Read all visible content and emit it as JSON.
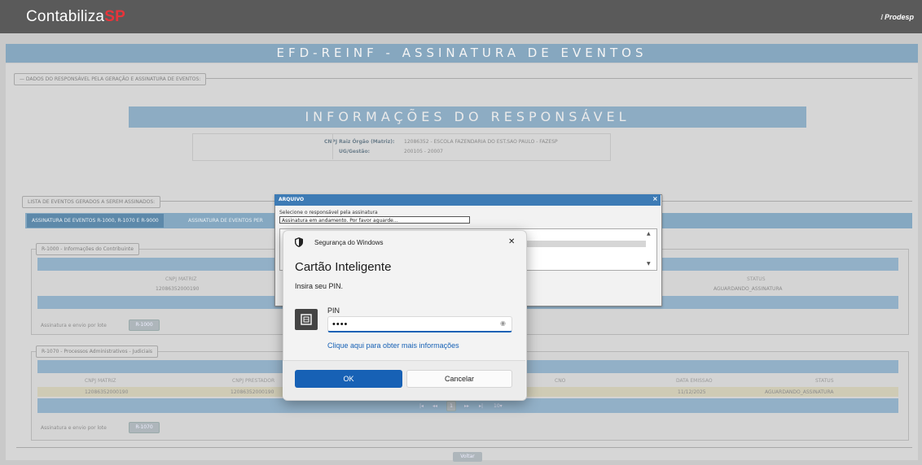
{
  "header": {
    "logo_main": "Contabiliza",
    "logo_accent": "SP",
    "brand_right": "Prodesp"
  },
  "page_title": "EFD-REINF - ASSINATURA DE EVENTOS",
  "resp_legend": "DADOS DO RESPONSÁVEL PELA GERAÇÃO E ASSINATURA DE EVENTOS:",
  "info": {
    "title": "INFORMAÇÕES DO RESPONSÁVEL",
    "cnpj_label": "CNPJ Raiz Órgão (Matriz):",
    "cnpj_value": "12086352 - ESCOLA FAZENDARIA DO EST.SAO PAULO - FAZESP",
    "ug_label": "UG/Gestão:",
    "ug_value": "200105 - 20007"
  },
  "list_legend": "LISTA DE EVENTOS GERADOS A SEREM ASSINADOS:",
  "tabs": [
    {
      "label": "ASSINATURA DE EVENTOS R-1000, R-1070 E R-9000"
    },
    {
      "label": "ASSINATURA DE EVENTOS PER"
    }
  ],
  "r1000": {
    "legend": "R-1000 - Informações do Contribuinte",
    "col_cnpj": "CNPJ MATRIZ",
    "col_status": "STATUS",
    "cnpj": "12086352000190",
    "status": "AGUARDANDO_ASSINATURA",
    "batch_label": "Assinatura e envio por lote",
    "batch_button": "R-1000"
  },
  "r1070": {
    "legend": "R-1070 - Processos Administrativos - Judiciais",
    "col_cnpj": "CNPJ MATRIZ",
    "col_prestador": "CNPJ PRESTADOR",
    "col_cno": "CNO",
    "col_data": "DATA EMISSAO",
    "col_status": "STATUS",
    "cnpj": "12086352000190",
    "prestador": "12086352000190",
    "data": "11/12/2025",
    "status": "AGUARDANDO_ASSINATURA",
    "page_num": "1",
    "page_size": "10",
    "batch_label": "Assinatura e envio por lote",
    "batch_button": "R-1070"
  },
  "back_button": "Voltar",
  "arquivo": {
    "title": "ARQUIVO",
    "close": "×",
    "select_label": "Selecione o responsável pela assinatura",
    "status_text": "Assinatura em andamento. Por favor aguarde..."
  },
  "win_dialog": {
    "header": "Segurança do Windows",
    "close": "✕",
    "title": "Cartão Inteligente",
    "subtitle": "Insira seu PIN.",
    "pin_label": "PIN",
    "pin_value": "••••",
    "more_info": "Clique aqui para obter mais informações",
    "ok": "OK",
    "cancel": "Cancelar"
  },
  "colors": {
    "accent": "#1761b5",
    "brand_red": "#e8343a",
    "title_blue": "#4f8bb7"
  }
}
